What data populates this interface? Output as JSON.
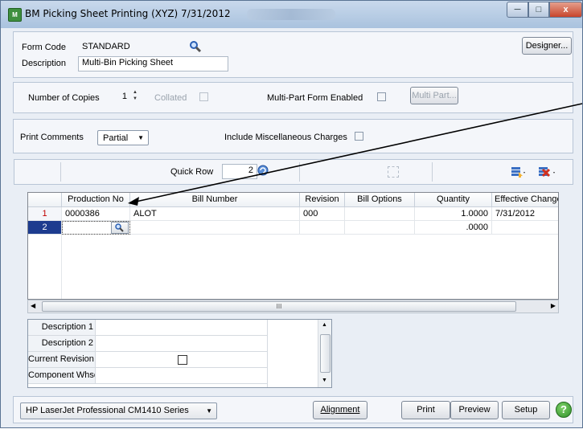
{
  "window": {
    "title": "BM Picking Sheet Printing (XYZ) 7/31/2012",
    "icon_label": "M",
    "min_glyph": "─",
    "max_glyph": "□",
    "close_glyph": "x"
  },
  "form": {
    "form_code_label": "Form Code",
    "form_code_value": "STANDARD",
    "description_label": "Description",
    "description_value": "Multi-Bin Picking Sheet",
    "designer_button": "Designer..."
  },
  "copies": {
    "label": "Number of Copies",
    "value": "1",
    "spinner_glyph": "▲▼",
    "collated_label": "Collated",
    "multipart_label": "Multi-Part Form Enabled",
    "multipart_button": "Multi Part..."
  },
  "comments": {
    "label": "Print Comments",
    "selected": "Partial",
    "misc_label": "Include Miscellaneous Charges"
  },
  "grid_toolbar": {
    "quick_row_label": "Quick Row",
    "quick_row_value": "2"
  },
  "grid": {
    "columns": [
      "Production No",
      "Bill Number",
      "Revision",
      "Bill Options",
      "Quantity",
      "Effective Change D"
    ],
    "rows": [
      {
        "num": "1",
        "production_no": "0000386",
        "bill_number": "ALOT",
        "revision": "000",
        "bill_options": "",
        "quantity": "1.0000",
        "effective": "7/31/2012"
      },
      {
        "num": "2",
        "production_no": "",
        "bill_number": "",
        "revision": "",
        "bill_options": "",
        "quantity": ".0000",
        "effective": ""
      }
    ],
    "scroll_thumb_glyph": "III"
  },
  "properties": {
    "rows": [
      {
        "label": "Description 1",
        "value": ""
      },
      {
        "label": "Description 2",
        "value": ""
      },
      {
        "label": "Current Revision",
        "value": ""
      },
      {
        "label": "Component Whse",
        "value": ""
      }
    ]
  },
  "bottom": {
    "printer": "HP LaserJet Professional CM1410 Series",
    "alignment": "Alignment",
    "print": "Print",
    "preview": "Preview",
    "setup": "Setup",
    "help_glyph": "?"
  },
  "colors": {
    "accent_blue": "#1d3c8f",
    "row_number_red": "#c00000"
  }
}
